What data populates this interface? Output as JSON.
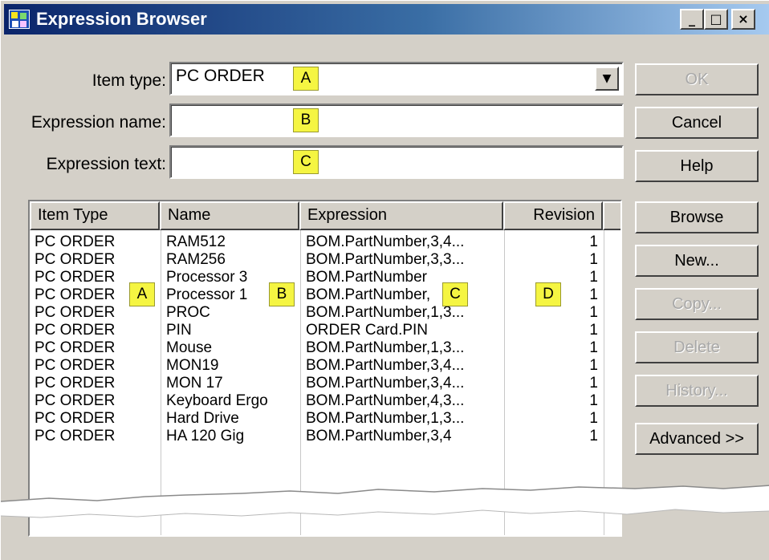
{
  "window": {
    "title": "Expression Browser",
    "controls": {
      "minimize": "_",
      "maximize": "□",
      "close": "×"
    }
  },
  "form": {
    "item_type": {
      "label": "Item type:",
      "value": "PC ORDER",
      "marker": "A"
    },
    "expression_name": {
      "label": "Expression name:",
      "value": "",
      "marker": "B"
    },
    "expression_text": {
      "label": "Expression text:",
      "value": "",
      "marker": "C"
    }
  },
  "buttons": {
    "ok": "OK",
    "cancel": "Cancel",
    "help": "Help",
    "browse": "Browse",
    "new": "New...",
    "copy": "Copy...",
    "delete": "Delete",
    "history": "History...",
    "advanced": "Advanced >>"
  },
  "table": {
    "columns": [
      "Item Type",
      "Name",
      "Expression",
      "Revision"
    ],
    "rows": [
      [
        "PC ORDER",
        "RAM512",
        "BOM.PartNumber,3,4...",
        "1"
      ],
      [
        "PC ORDER",
        "RAM256",
        "BOM.PartNumber,3,3...",
        "1"
      ],
      [
        "PC ORDER",
        "Processor 3",
        "BOM.PartNumber",
        "1"
      ],
      [
        "PC ORDER",
        "Processor 1",
        "BOM.PartNumber,",
        "1"
      ],
      [
        "PC ORDER",
        "PROC",
        "BOM.PartNumber,1,3...",
        "1"
      ],
      [
        "PC ORDER",
        "PIN",
        "ORDER Card.PIN",
        "1"
      ],
      [
        "PC ORDER",
        "Mouse",
        "BOM.PartNumber,1,3...",
        "1"
      ],
      [
        "PC ORDER",
        "MON19",
        "BOM.PartNumber,3,4...",
        "1"
      ],
      [
        "PC ORDER",
        "MON 17",
        "BOM.PartNumber,3,4...",
        "1"
      ],
      [
        "PC ORDER",
        "Keyboard Ergo",
        "BOM.PartNumber,4,3...",
        "1"
      ],
      [
        "PC ORDER",
        "Hard Drive",
        "BOM.PartNumber,1,3...",
        "1"
      ],
      [
        "PC ORDER",
        "HA 120 Gig",
        "BOM.PartNumber,3,4",
        "1"
      ]
    ],
    "markers": [
      "A",
      "B",
      "C",
      "D"
    ]
  }
}
